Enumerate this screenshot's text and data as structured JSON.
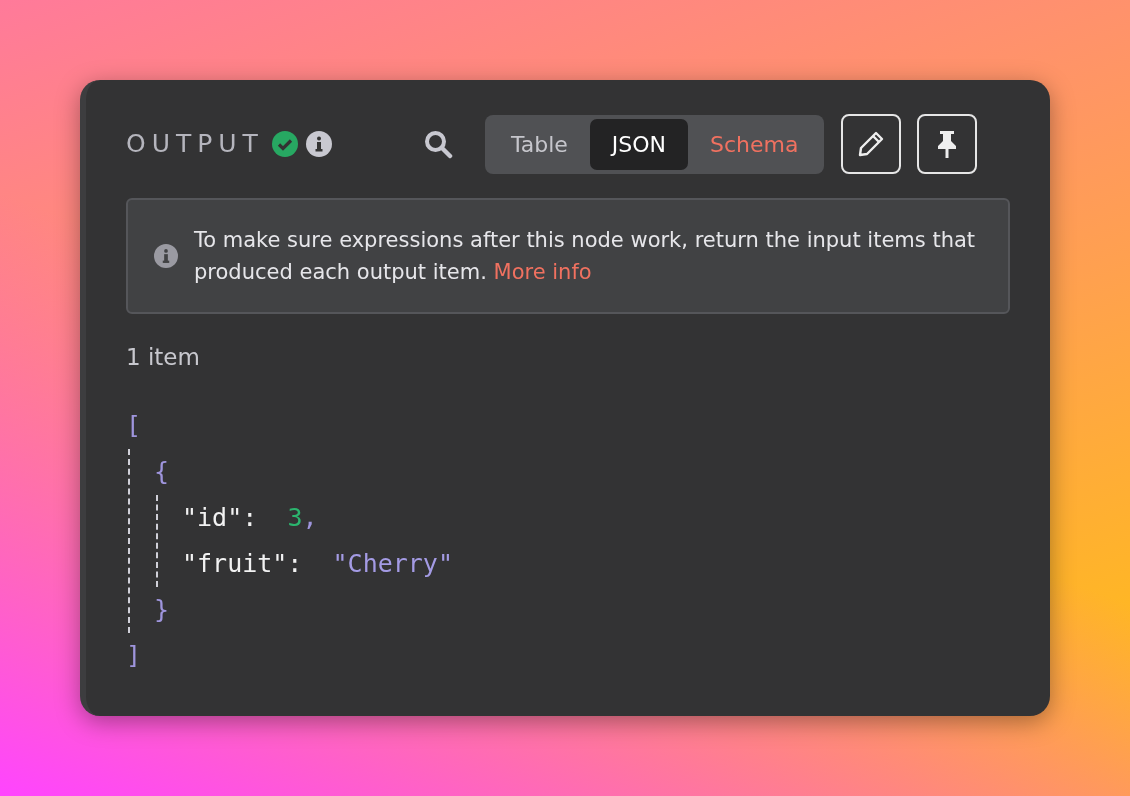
{
  "panel": {
    "title": "OUTPUT",
    "succeeded": true,
    "view_tabs": [
      {
        "label": "Table",
        "selected": false
      },
      {
        "label": "JSON",
        "selected": true
      },
      {
        "label": "Schema",
        "selected": false
      }
    ],
    "notice": {
      "text": "To make sure expressions after this node work, return the input items that produced each output item. ",
      "link": "More info"
    },
    "item_count": "1 item",
    "json_view": {
      "open": "[",
      "object_open": "{",
      "fields": [
        {
          "key": "\"id\":",
          "value": "3",
          "kind": "number",
          "comma": ","
        },
        {
          "key": "\"fruit\":",
          "value": "\"Cherry\"",
          "kind": "string"
        }
      ],
      "object_close": "}",
      "close": "]"
    }
  }
}
